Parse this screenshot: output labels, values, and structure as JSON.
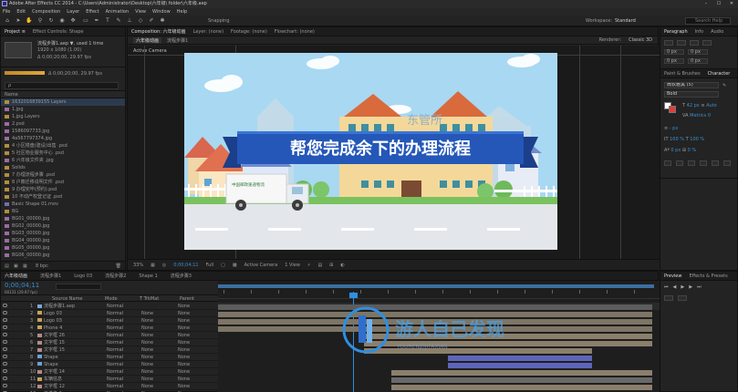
{
  "app": {
    "title": "Adobe After Effects CC 2014 - C:\\Users\\Administrator\\Desktop\\六年级\\ folder\\六年级.aep",
    "window_buttons": [
      "–",
      "☐",
      "✕"
    ]
  },
  "menu": [
    "File",
    "Edit",
    "Composition",
    "Layer",
    "Effect",
    "Animation",
    "View",
    "Window",
    "Help"
  ],
  "toolbar": {
    "snapping_label": "Snapping",
    "workspace_label": "Workspace:",
    "workspace_value": "Standard",
    "search_placeholder": "Search Help"
  },
  "project_panel": {
    "tabs": [
      "Project ≡",
      "Effect Controls: Shape"
    ],
    "item_name": "流程步骤1.aep ▼, used 1 time",
    "item_info": "1920 x 1080 (1.00)",
    "item_duration": "Δ 0;00;20;00, 29.97 fps",
    "search_placeholder": "ρ",
    "bpc": "8 bpc",
    "header_name": "Name",
    "items": [
      {
        "name": "1632016839155 Layers",
        "type": "folder"
      },
      {
        "name": "1.jpg",
        "type": "img"
      },
      {
        "name": "1.jpg Layers",
        "type": "folder"
      },
      {
        "name": "2.psd",
        "type": "img"
      },
      {
        "name": "1586097733.jpg",
        "type": "img"
      },
      {
        "name": "4a567797374.jpg",
        "type": "img"
      },
      {
        "name": "4 小区楼盘(建设)出售 .psd",
        "type": "folder"
      },
      {
        "name": "5 社区物业服务中心 .psd",
        "type": "folder"
      },
      {
        "name": "6 六年级文件夹 .jpg",
        "type": "img"
      },
      {
        "name": "Solids",
        "type": "folder"
      },
      {
        "name": "7 办理流程步骤 .psd",
        "type": "folder"
      },
      {
        "name": "8 户籍迁移说明文件 .psd",
        "type": "folder"
      },
      {
        "name": "9 办理完毕(预约).psd",
        "type": "folder"
      },
      {
        "name": "10 不动产权登记证 .psd",
        "type": "folder"
      },
      {
        "name": "Basic Shape 01.mov",
        "type": "comp"
      },
      {
        "name": "BG",
        "type": "folder"
      },
      {
        "name": "BG01_00000.jpg",
        "type": "img"
      },
      {
        "name": "BG02_00000.jpg",
        "type": "img"
      },
      {
        "name": "BG03_00000.jpg",
        "type": "img"
      },
      {
        "name": "BG04_00000.jpg",
        "type": "img"
      },
      {
        "name": "BG05_00000.jpg",
        "type": "img"
      },
      {
        "name": "BG06_00000.jpg",
        "type": "img"
      }
    ]
  },
  "comp_panel": {
    "tabs": [
      "Composition: 六年级动画",
      "Layer: (none)",
      "Footage: (none)",
      "Flowchart: (none)"
    ],
    "subtabs": [
      "六年级动画",
      "流程步骤1"
    ],
    "view_label": "Active Camera",
    "renderer_label": "Renderer:",
    "renderer_value": "Classic 3D",
    "banner_text": "帮您完成余下的办理流程",
    "truck_text": "中国邮政速递物流",
    "bg_text": "东管所",
    "zoom": "33%",
    "timecode": "0;00;04;11",
    "resolution": "Full",
    "camera": "Active Camera",
    "views": "1 View"
  },
  "right_panel": {
    "tabs1": [
      "Paragraph",
      "Info",
      "Audio"
    ],
    "tabs2": [
      "Paint & Brushes",
      "Character"
    ],
    "tabs3": [
      "Preview",
      "Effects & Presets"
    ],
    "font": "微软雅黑 (5)",
    "style": "Bold",
    "size_label": "42 px",
    "leading_label": "Auto",
    "tracking_label": "0",
    "metrics_label": "Metrics",
    "stroke_label": "- px",
    "scale_label": "100 %",
    "baseline_label": "0 px",
    "tsume_label": "0 %"
  },
  "timeline": {
    "tabs": [
      "六年级动画",
      "流程步骤1",
      "Logo 03",
      "流程步骤2",
      "Shape 1",
      "流程步骤3"
    ],
    "timecode": "0;00;04;11",
    "timecode_sub": "00131 (29.97 fps)",
    "col_source": "Source Name",
    "col_mode": "Mode",
    "col_trkmat": "T TrkMat",
    "col_parent": "Parent",
    "layers": [
      {
        "num": "1",
        "name": "流程步骤1.aep",
        "mode": "Normal",
        "trk": "",
        "parent": "None",
        "color": "#7aa7d6"
      },
      {
        "num": "2",
        "name": "Logo 03",
        "mode": "Normal",
        "trk": "None",
        "parent": "None",
        "color": "#c4a35a"
      },
      {
        "num": "3",
        "name": "Logo 03",
        "mode": "Normal",
        "trk": "None",
        "parent": "None",
        "color": "#c4a35a"
      },
      {
        "num": "4",
        "name": "Phone 4",
        "mode": "Normal",
        "trk": "None",
        "parent": "None",
        "color": "#c4a35a"
      },
      {
        "num": "5",
        "name": "文字框 26",
        "mode": "Normal",
        "trk": "None",
        "parent": "None",
        "color": "#b58a8a"
      },
      {
        "num": "6",
        "name": "文字框 15",
        "mode": "Normal",
        "trk": "None",
        "parent": "None",
        "color": "#b58a8a"
      },
      {
        "num": "7",
        "name": "文字框 15",
        "mode": "Normal",
        "trk": "None",
        "parent": "None",
        "color": "#b58a8a"
      },
      {
        "num": "8",
        "name": "Shape",
        "mode": "Normal",
        "trk": "None",
        "parent": "None",
        "color": "#6f9fd8"
      },
      {
        "num": "9",
        "name": "Shape",
        "mode": "Normal",
        "trk": "None",
        "parent": "None",
        "color": "#6f9fd8"
      },
      {
        "num": "10",
        "name": "文字框 14",
        "mode": "Normal",
        "trk": "None",
        "parent": "None",
        "color": "#b58a8a"
      },
      {
        "num": "11",
        "name": "车辆信息",
        "mode": "Normal",
        "trk": "None",
        "parent": "None",
        "color": "#c4a35a"
      },
      {
        "num": "12",
        "name": "文字框 12",
        "mode": "Normal",
        "trk": "None",
        "parent": "None",
        "color": "#b58a8a"
      },
      {
        "num": "13",
        "name": "文件夹 2",
        "mode": "Normal",
        "trk": "None",
        "parent": "None",
        "color": "#c4a35a"
      }
    ],
    "watermark_text": "游人自己发现",
    "watermark_sub": "YOURENZIJIFAXIAN"
  },
  "colors": {
    "accent_blue": "#2f8fe0",
    "banner_blue": "#2457b8",
    "bar_tan": "#8b7f6c",
    "bar_blue": "#5d66b8",
    "bar_gray": "#696969"
  }
}
